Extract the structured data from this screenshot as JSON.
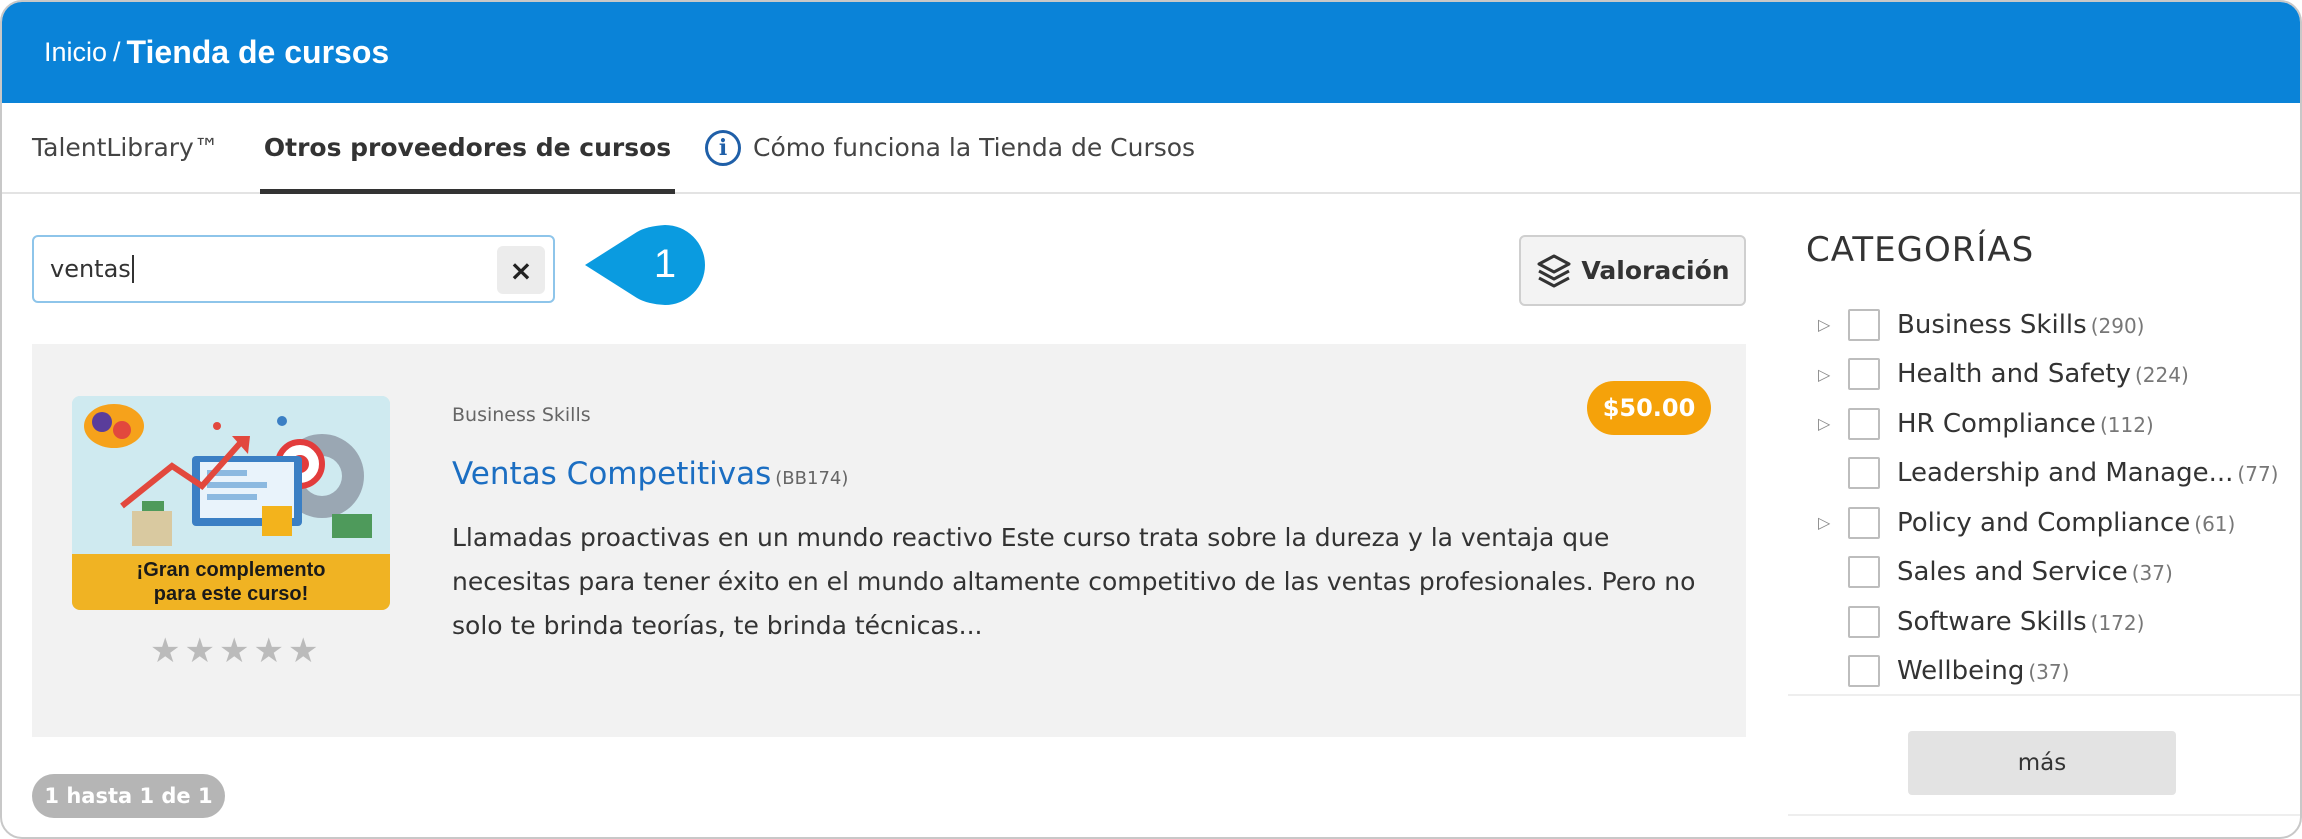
{
  "header": {
    "breadcrumb_link": "Inicio",
    "breadcrumb_separator": "/",
    "page_title": "Tienda de cursos",
    "bg_color": "#0a83d8"
  },
  "tabs": [
    {
      "label": "TalentLibrary™",
      "active": false
    },
    {
      "label": "Otros proveedores de cursos",
      "active": true
    },
    {
      "label": "Cómo funciona la Tienda de Cursos",
      "icon": "info-icon",
      "active": false
    }
  ],
  "search": {
    "value": "ventas",
    "clear_label": "×"
  },
  "callout": {
    "number": "1",
    "color": "#0a9be0"
  },
  "sort_button": {
    "label": "Valoración",
    "icon": "layers-icon"
  },
  "course": {
    "category": "Business Skills",
    "title": "Ventas Competitivas",
    "code": "(BB174)",
    "description": "Llamadas proactivas en un mundo reactivo Este curso trata sobre la dureza y la ventaja que necesitas para tener éxito en el mundo altamente competitivo de las ventas profesionales. Pero no solo te brinda teorías, te brinda técnicas...",
    "price": "$50.00",
    "thumbnail_line1": "¡Gran complemento",
    "thumbnail_line2": "para este curso!",
    "rating_stars": 0,
    "rating_max": 5
  },
  "pagination": {
    "label": "1 hasta 1 de 1"
  },
  "sidebar": {
    "title": "CATEGORÍAS",
    "categories": [
      {
        "label": "Business Skills",
        "count": "(290)",
        "expandable": true
      },
      {
        "label": "Health and Safety",
        "count": "(224)",
        "expandable": true
      },
      {
        "label": "HR Compliance",
        "count": "(112)",
        "expandable": true
      },
      {
        "label": "Leadership and Manage...",
        "count": "(77)",
        "expandable": false
      },
      {
        "label": "Policy and Compliance",
        "count": "(61)",
        "expandable": true
      },
      {
        "label": "Sales and Service",
        "count": "(37)",
        "expandable": false
      },
      {
        "label": "Software Skills",
        "count": "(172)",
        "expandable": false
      },
      {
        "label": "Wellbeing",
        "count": "(37)",
        "expandable": false
      }
    ],
    "more_label": "más"
  }
}
